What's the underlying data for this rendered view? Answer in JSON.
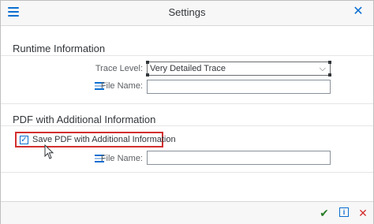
{
  "header": {
    "title": "Settings"
  },
  "runtime": {
    "title": "Runtime Information",
    "trace_label": "Trace Level:",
    "trace_value": "Very Detailed Trace",
    "file_label": "File Name:",
    "file_value": ""
  },
  "pdf": {
    "title": "PDF with Additional Information",
    "checkbox_label": "Save PDF with Additional Information",
    "checkbox_checked": true,
    "file_label": "File Name:",
    "file_value": ""
  },
  "icons": {
    "menu": "menu-icon",
    "close": "close-icon",
    "file": "file-list-icon",
    "ok": "checkmark-icon",
    "info": "info-icon",
    "cancel": "cross-icon"
  },
  "colors": {
    "accent": "#0a6ed1",
    "highlight": "#d32f2f",
    "ok": "#2b7d2b"
  }
}
